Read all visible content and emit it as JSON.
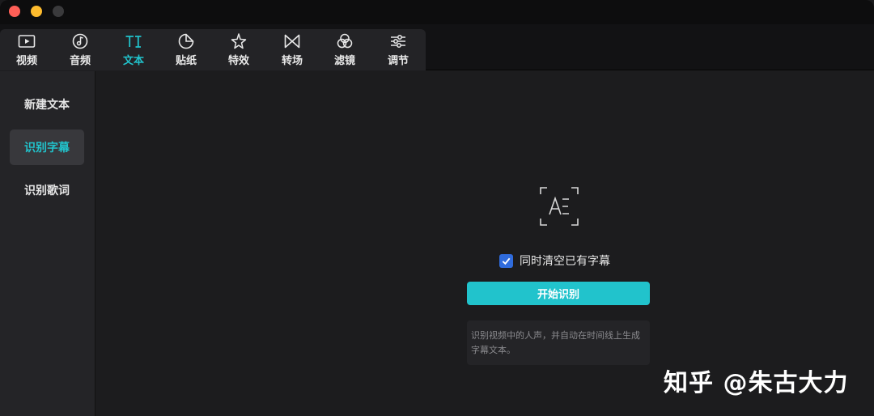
{
  "toolbar": {
    "tabs": [
      {
        "label": "视频",
        "icon": "video-icon"
      },
      {
        "label": "音频",
        "icon": "music-note-icon"
      },
      {
        "label": "文本",
        "icon": "text-icon"
      },
      {
        "label": "贴纸",
        "icon": "sticker-icon"
      },
      {
        "label": "特效",
        "icon": "sparkle-star-icon"
      },
      {
        "label": "转场",
        "icon": "transition-bowtie-icon"
      },
      {
        "label": "滤镜",
        "icon": "filter-circles-icon"
      },
      {
        "label": "调节",
        "icon": "sliders-icon"
      }
    ],
    "active_tab": "文本"
  },
  "sidebar": {
    "items": [
      {
        "label": "新建文本"
      },
      {
        "label": "识别字幕"
      },
      {
        "label": "识别歌词"
      }
    ],
    "active_item": "识别字幕"
  },
  "main": {
    "icon": "text-recognition-icon",
    "clear_checkbox": {
      "label": "同时清空已有字幕",
      "checked": true
    },
    "start_button": "开始识别",
    "description": "识别视频中的人声，并自动在时间线上生成字幕文本。"
  },
  "watermark": "知乎 @朱古大力",
  "colors": {
    "accent": "#21c3cc",
    "checkbox": "#2f6bdc",
    "background": "#1c1c1e",
    "sidebar": "#242427"
  }
}
